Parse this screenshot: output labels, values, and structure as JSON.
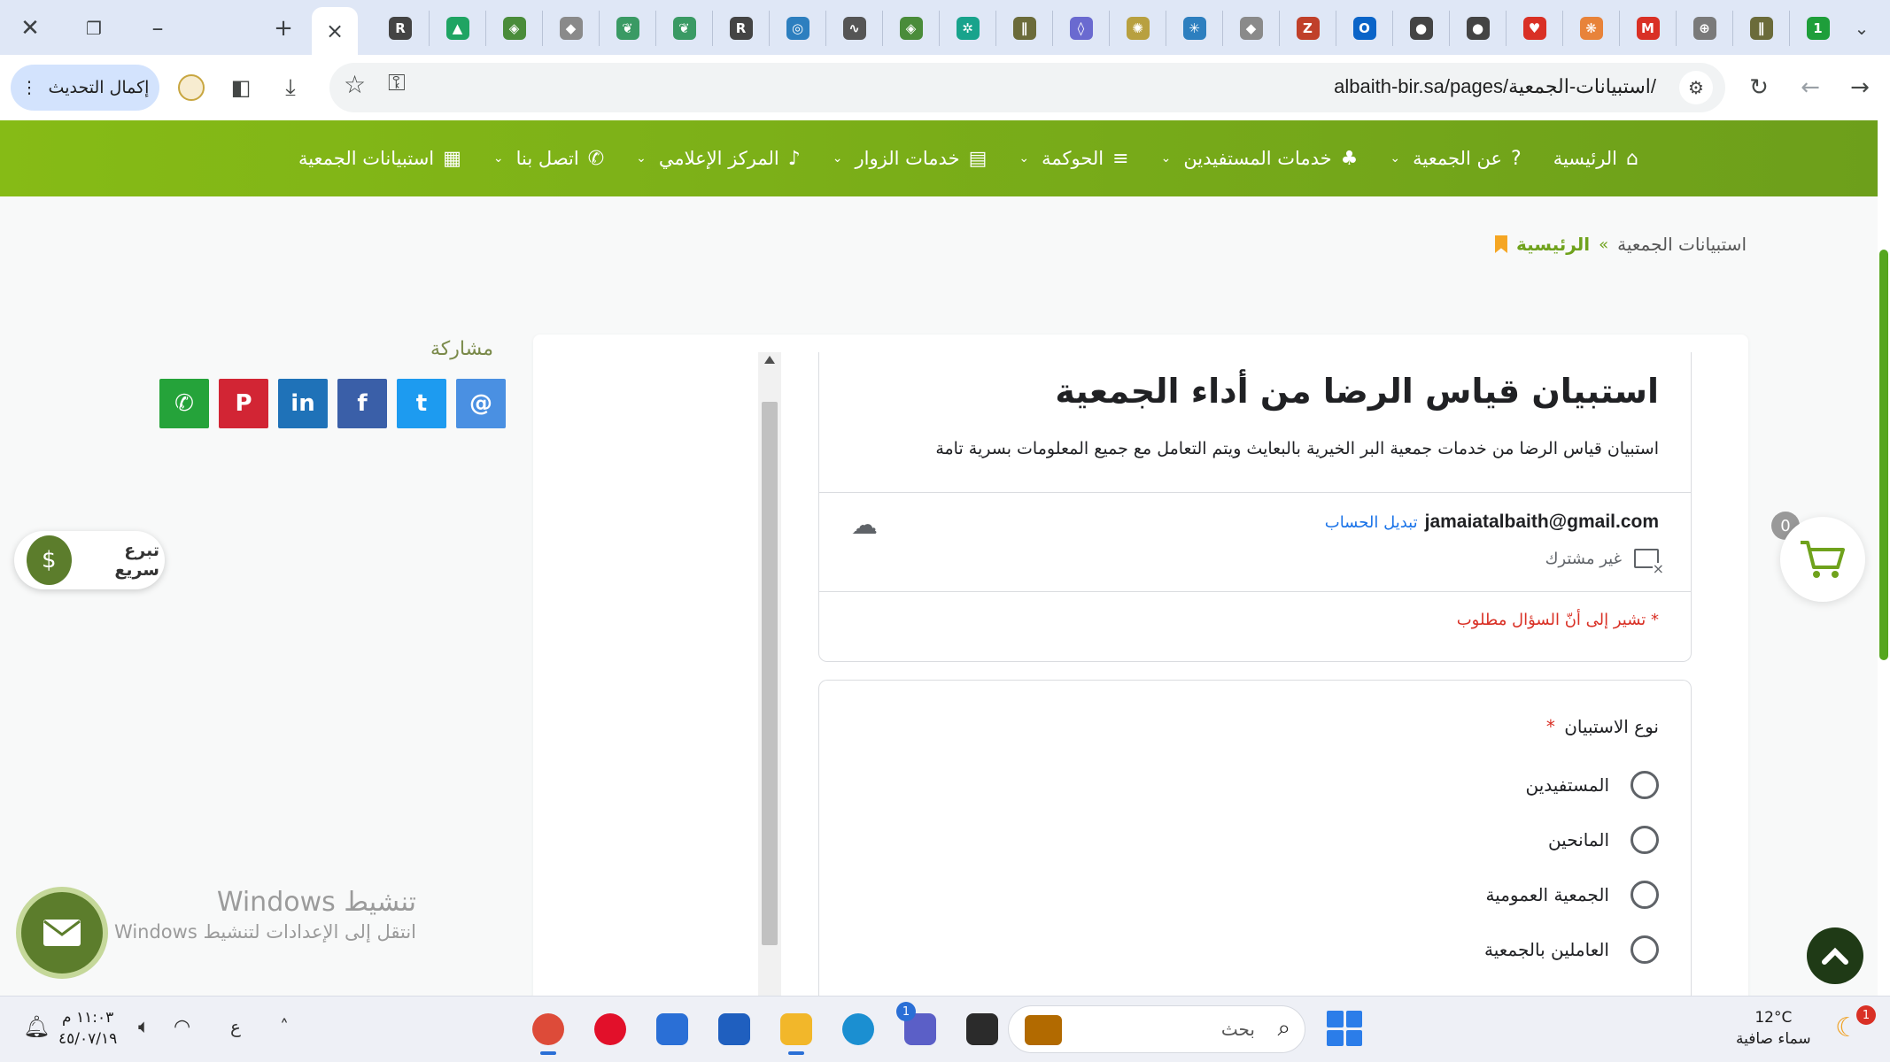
{
  "browser": {
    "close_tab_glyph": "×",
    "tab_icons": [
      {
        "name": "r-app",
        "color": "#444444",
        "glyph": "R"
      },
      {
        "name": "drive",
        "color": "#1fa463",
        "glyph": "▲"
      },
      {
        "name": "app-green",
        "color": "#4a8c3a",
        "glyph": "◈"
      },
      {
        "name": "app-grey",
        "color": "#8a8a8a",
        "glyph": "◆"
      },
      {
        "name": "app-leaf",
        "color": "#3a9a64",
        "glyph": "❦"
      },
      {
        "name": "app-leaf2",
        "color": "#3a9a64",
        "glyph": "❦"
      },
      {
        "name": "r-app2",
        "color": "#444444",
        "glyph": "R"
      },
      {
        "name": "app-circle",
        "color": "#2d7fbf",
        "glyph": "◎"
      },
      {
        "name": "app-sign",
        "color": "#555555",
        "glyph": "∿"
      },
      {
        "name": "app-green2",
        "color": "#4a8c3a",
        "glyph": "◈"
      },
      {
        "name": "app-teal",
        "color": "#18a38c",
        "glyph": "✲"
      },
      {
        "name": "app-stripes",
        "color": "#6b6b3a",
        "glyph": "∥"
      },
      {
        "name": "app-drop",
        "color": "#6a6ad0",
        "glyph": "◊"
      },
      {
        "name": "app-seal",
        "color": "#b8a040",
        "glyph": "✺"
      },
      {
        "name": "app-star",
        "color": "#2d7fbf",
        "glyph": "✳"
      },
      {
        "name": "app-grey2",
        "color": "#8a8a8a",
        "glyph": "◆"
      },
      {
        "name": "app-z",
        "color": "#c0402a",
        "glyph": "Z"
      },
      {
        "name": "outlook",
        "color": "#0a64c8",
        "glyph": "O"
      },
      {
        "name": "app-dark",
        "color": "#444444",
        "glyph": "●"
      },
      {
        "name": "app-dark2",
        "color": "#444444",
        "glyph": "●"
      },
      {
        "name": "app-heart",
        "color": "#d93025",
        "glyph": "♥"
      },
      {
        "name": "app-orange",
        "color": "#e8833a",
        "glyph": "❋"
      },
      {
        "name": "gmail",
        "color": "#d93025",
        "glyph": "M"
      },
      {
        "name": "app-globe",
        "color": "#7a7a7a",
        "glyph": "⊕"
      },
      {
        "name": "app-stripes2",
        "color": "#6b6b3a",
        "glyph": "∥"
      },
      {
        "name": "app-one",
        "color": "#1e9e3a",
        "glyph": "1"
      }
    ],
    "update_button": "إكمال التحديث",
    "url": "albaith-bir.sa/pages/استبيانات-الجمعية/"
  },
  "nav": {
    "items": [
      {
        "label": "الرئيسية",
        "icon": "home-icon",
        "glyph": "⌂",
        "caret": false
      },
      {
        "label": "عن الجمعية",
        "icon": "question-icon",
        "glyph": "?",
        "caret": true
      },
      {
        "label": "خدمات المستفيدين",
        "icon": "users-icon",
        "glyph": "♣",
        "caret": true
      },
      {
        "label": "الحوكمة",
        "icon": "list-icon",
        "glyph": "≡",
        "caret": true
      },
      {
        "label": "خدمات الزوار",
        "icon": "table-icon",
        "glyph": "▤",
        "caret": true
      },
      {
        "label": "المركز الإعلامي",
        "icon": "mic-icon",
        "glyph": "♪",
        "caret": true
      },
      {
        "label": "اتصل بنا",
        "icon": "phone-icon",
        "glyph": "✆",
        "caret": true
      },
      {
        "label": "استبيانات الجمعية",
        "icon": "poll-icon",
        "glyph": "▦",
        "caret": false
      }
    ]
  },
  "breadcrumb": {
    "home": "الرئيسية",
    "separator": "»",
    "current": "استبيانات الجمعية"
  },
  "form": {
    "title": "استبيان قياس الرضا من أداء الجمعية",
    "description": "استبيان قياس الرضا من خدمات جمعية البر الخيرية بالبعايث ويتم التعامل مع جميع المعلومات بسرية تامة",
    "account_email": "jamaiatalbaith@gmail.com",
    "switch_account": "تبديل الحساب",
    "not_shared": "غير مشترك",
    "required_note": "* تشير إلى أنّ السؤال مطلوب",
    "question": {
      "title": "نوع الاستبيان",
      "required_mark": "*",
      "options": [
        "المستفيدين",
        "المانحين",
        "الجمعية العمومية",
        "العاملين بالجمعية"
      ]
    }
  },
  "share": {
    "title": "مشاركة",
    "buttons": [
      {
        "name": "whatsapp",
        "color": "#25a33a",
        "glyph": "✆"
      },
      {
        "name": "pinterest",
        "color": "#d22534",
        "glyph": "P"
      },
      {
        "name": "linkedin",
        "color": "#1f72b8",
        "glyph": "in"
      },
      {
        "name": "facebook",
        "color": "#3a5fa8",
        "glyph": "f"
      },
      {
        "name": "twitter",
        "color": "#1d9bf0",
        "glyph": "t"
      },
      {
        "name": "email",
        "color": "#4a90e2",
        "glyph": "@"
      }
    ]
  },
  "quick_donate": {
    "label": "تبرع سريع"
  },
  "cart": {
    "count": "0"
  },
  "windows_activation": {
    "title": "تنشيط Windows",
    "subtitle": "انتقل إلى الإعدادات لتنشيط Windows"
  },
  "taskbar": {
    "time": "١١:٠٣ م",
    "date": "٤٥/٠٧/١٩",
    "lang": "ع",
    "search_label": "بحث",
    "weather_temp": "12°C",
    "weather_desc": "سماء صافية",
    "weather_badge": "1",
    "chat_badge": "1",
    "apps": [
      {
        "name": "chrome",
        "color": "#dd4b39",
        "active": true
      },
      {
        "name": "opera",
        "color": "#e2102a",
        "active": false
      },
      {
        "name": "mail",
        "color": "#2a6fd6",
        "active": false
      },
      {
        "name": "store",
        "color": "#1f5fbf",
        "active": false
      },
      {
        "name": "file-explorer",
        "color": "#f2b72a",
        "active": true
      },
      {
        "name": "edge",
        "color": "#1b8fd1",
        "active": false
      },
      {
        "name": "teams",
        "color": "#5b5fc7",
        "active": false
      },
      {
        "name": "terminal",
        "color": "#2b2b2b",
        "active": false
      }
    ]
  },
  "colors": {
    "nav_green": "#7aae18",
    "brand_dark_green": "#5c7d2c",
    "required_red": "#d93025",
    "link_blue": "#1a73e8"
  }
}
